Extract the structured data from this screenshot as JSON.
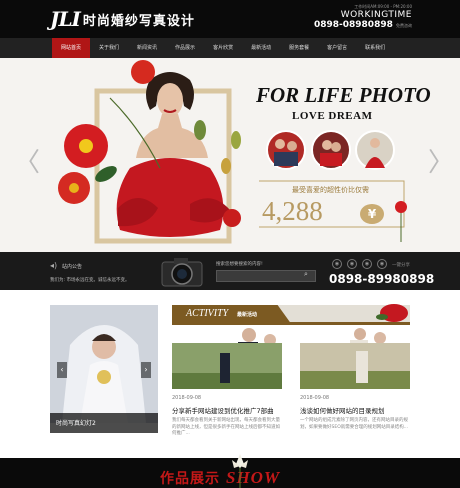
{
  "header": {
    "logo_mark": "JLI",
    "logo_name": "时尚婚纱写真设计",
    "worktime_line": "工作时间AM:09:00 - PM:20:00",
    "worktime_label": "WORKINGTIME",
    "phone": "0898-08980898",
    "phone_suffix": "免费咨询"
  },
  "nav": {
    "items": [
      "网站首页",
      "关于我们",
      "新闻资讯",
      "作品展示",
      "客片欣赏",
      "最新活动",
      "服务套餐",
      "客户留言",
      "联系我们"
    ],
    "active_index": 0
  },
  "banner": {
    "headline": "FOR LIFE PHOTO",
    "subheadline": "LOVE DREAM",
    "price_label": "最受喜爱的超性价比仅需",
    "price": "4,288",
    "currency_symbol": "¥",
    "prev_arrow": "〈",
    "next_arrow": "〉"
  },
  "infobar": {
    "news_label": "站内公告",
    "notice": "我们为: 市场永远在变。诚信永远不变。",
    "hot_search": "搜索您想要搜索的内容!",
    "search_placeholder": "",
    "search_icon": "search-icon",
    "phone": "0898-89980898",
    "onekey": "一键分享"
  },
  "slider": {
    "caption": "时尚写真幻灯2",
    "prev": "‹",
    "next": "›"
  },
  "activity": {
    "title_en": "ACTIVITY",
    "title_cn": "最新活动",
    "items": [
      {
        "date": "2018-09-08",
        "title": "分享新手网站建设到优化推广7部曲",
        "desc": "我们每天都会看到关于新网站出现，每天都会看到大量的新网站上线，但是很多新手在网站上线后都不知道如何推广..."
      },
      {
        "date": "2018-09-08",
        "title": "浅谈如何做好网站的目录规划",
        "desc": "一个网站的组成元素除了网页内容，还有网站目录的规划，如果要做好SEO就需要合理的规划网站目录结构..."
      }
    ]
  },
  "footer": {
    "show_cn": "作品展示",
    "show_en": "SHOW"
  },
  "colors": {
    "brand_red": "#b01616",
    "gold": "#b79a62",
    "dark": "#0a0a0a"
  }
}
